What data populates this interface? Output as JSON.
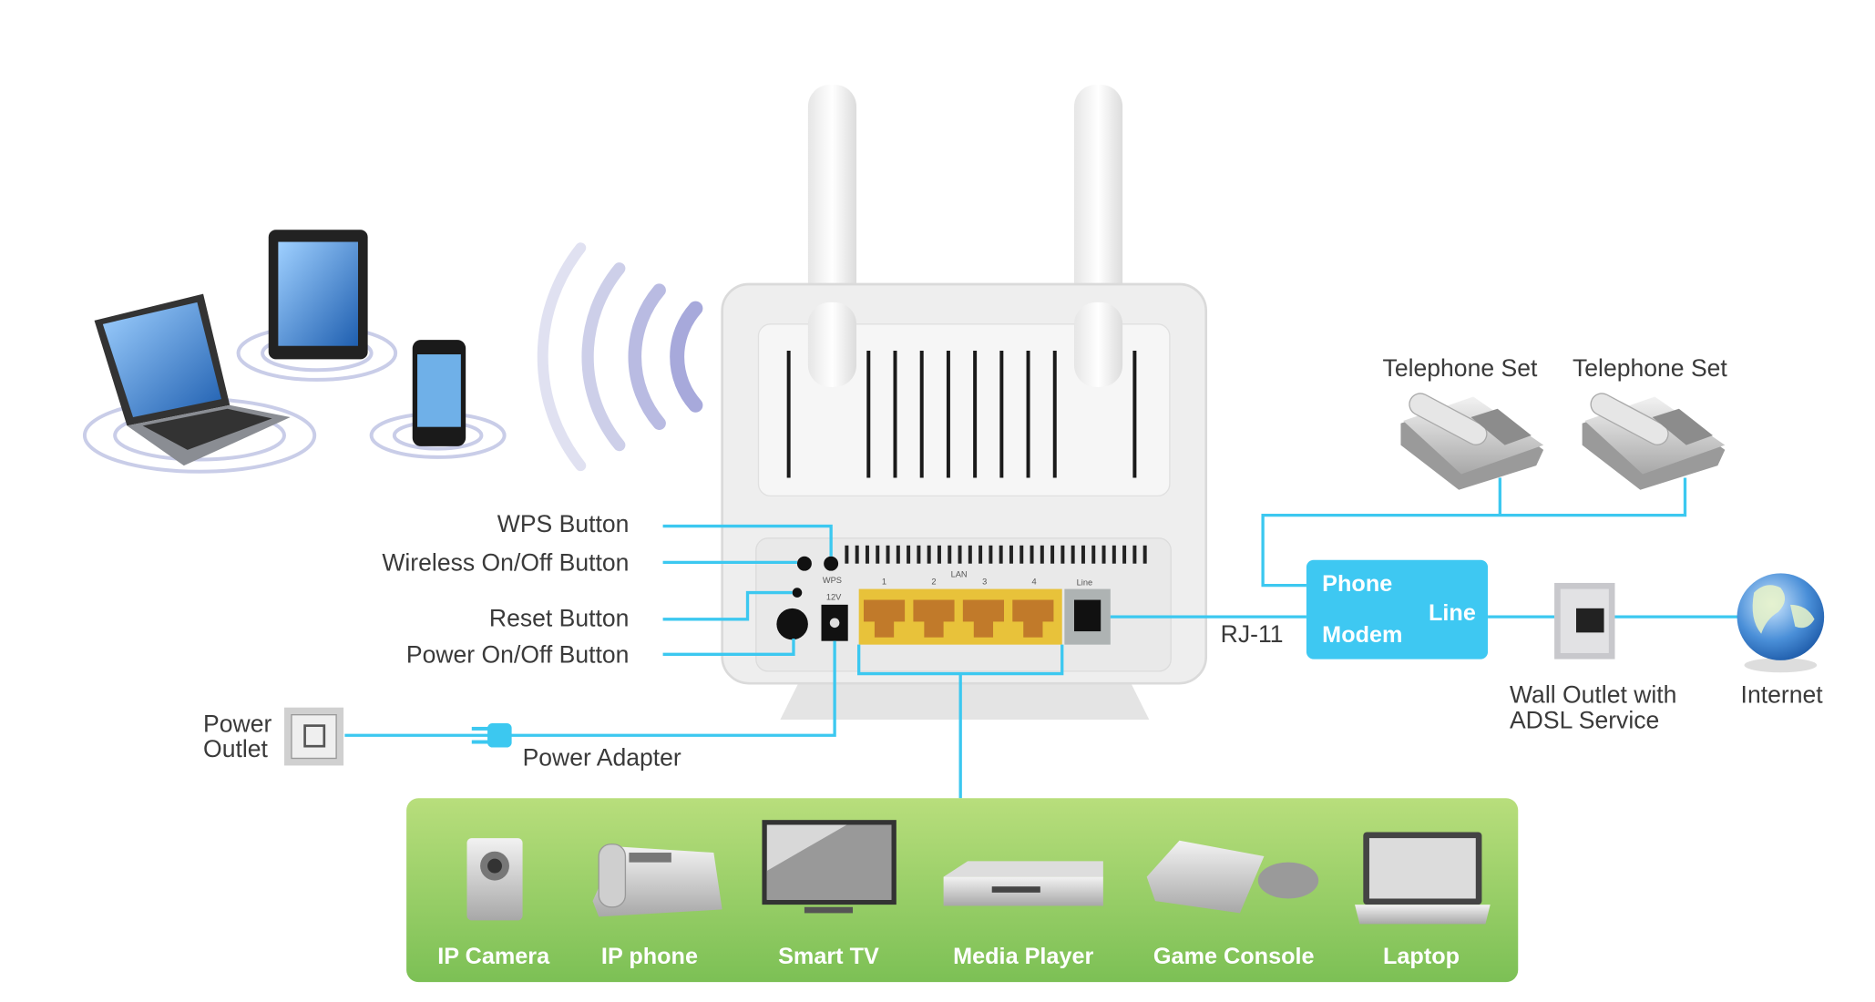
{
  "labels": {
    "wps_button": "WPS Button",
    "wireless_button": "Wireless On/Off Button",
    "reset_button": "Reset Button",
    "power_button": "Power On/Off Button",
    "power_outlet": "Power\nOutlet",
    "power_outlet_line1": "Power",
    "power_outlet_line2": "Outlet",
    "power_adapter": "Power Adapter",
    "telephone_1": "Telephone Set",
    "telephone_2": "Telephone Set",
    "rj11": "RJ-11",
    "wall_outlet_line1": "Wall Outlet with",
    "wall_outlet_line2": "ADSL Service",
    "internet": "Internet"
  },
  "modem": {
    "phone": "Phone",
    "modem": "Modem",
    "line": "Line"
  },
  "router_panel": {
    "wps": "WPS",
    "v12": "12V",
    "lan": "LAN",
    "line": "Line",
    "ports": [
      "1",
      "2",
      "3",
      "4"
    ]
  },
  "lan_devices": [
    {
      "label": "IP Camera",
      "icon": "ip-camera-icon"
    },
    {
      "label": "IP phone",
      "icon": "ip-phone-icon"
    },
    {
      "label": "Smart TV",
      "icon": "smart-tv-icon"
    },
    {
      "label": "Media Player",
      "icon": "media-player-icon"
    },
    {
      "label": "Game Console",
      "icon": "game-console-icon"
    },
    {
      "label": "Laptop",
      "icon": "laptop-icon"
    }
  ],
  "colors": {
    "connector": "#3cc8f0",
    "modem": "#3ec8f2",
    "panel_top": "#b8de7c",
    "panel_bottom": "#7cc055",
    "lan_port": "#e8c23a"
  }
}
